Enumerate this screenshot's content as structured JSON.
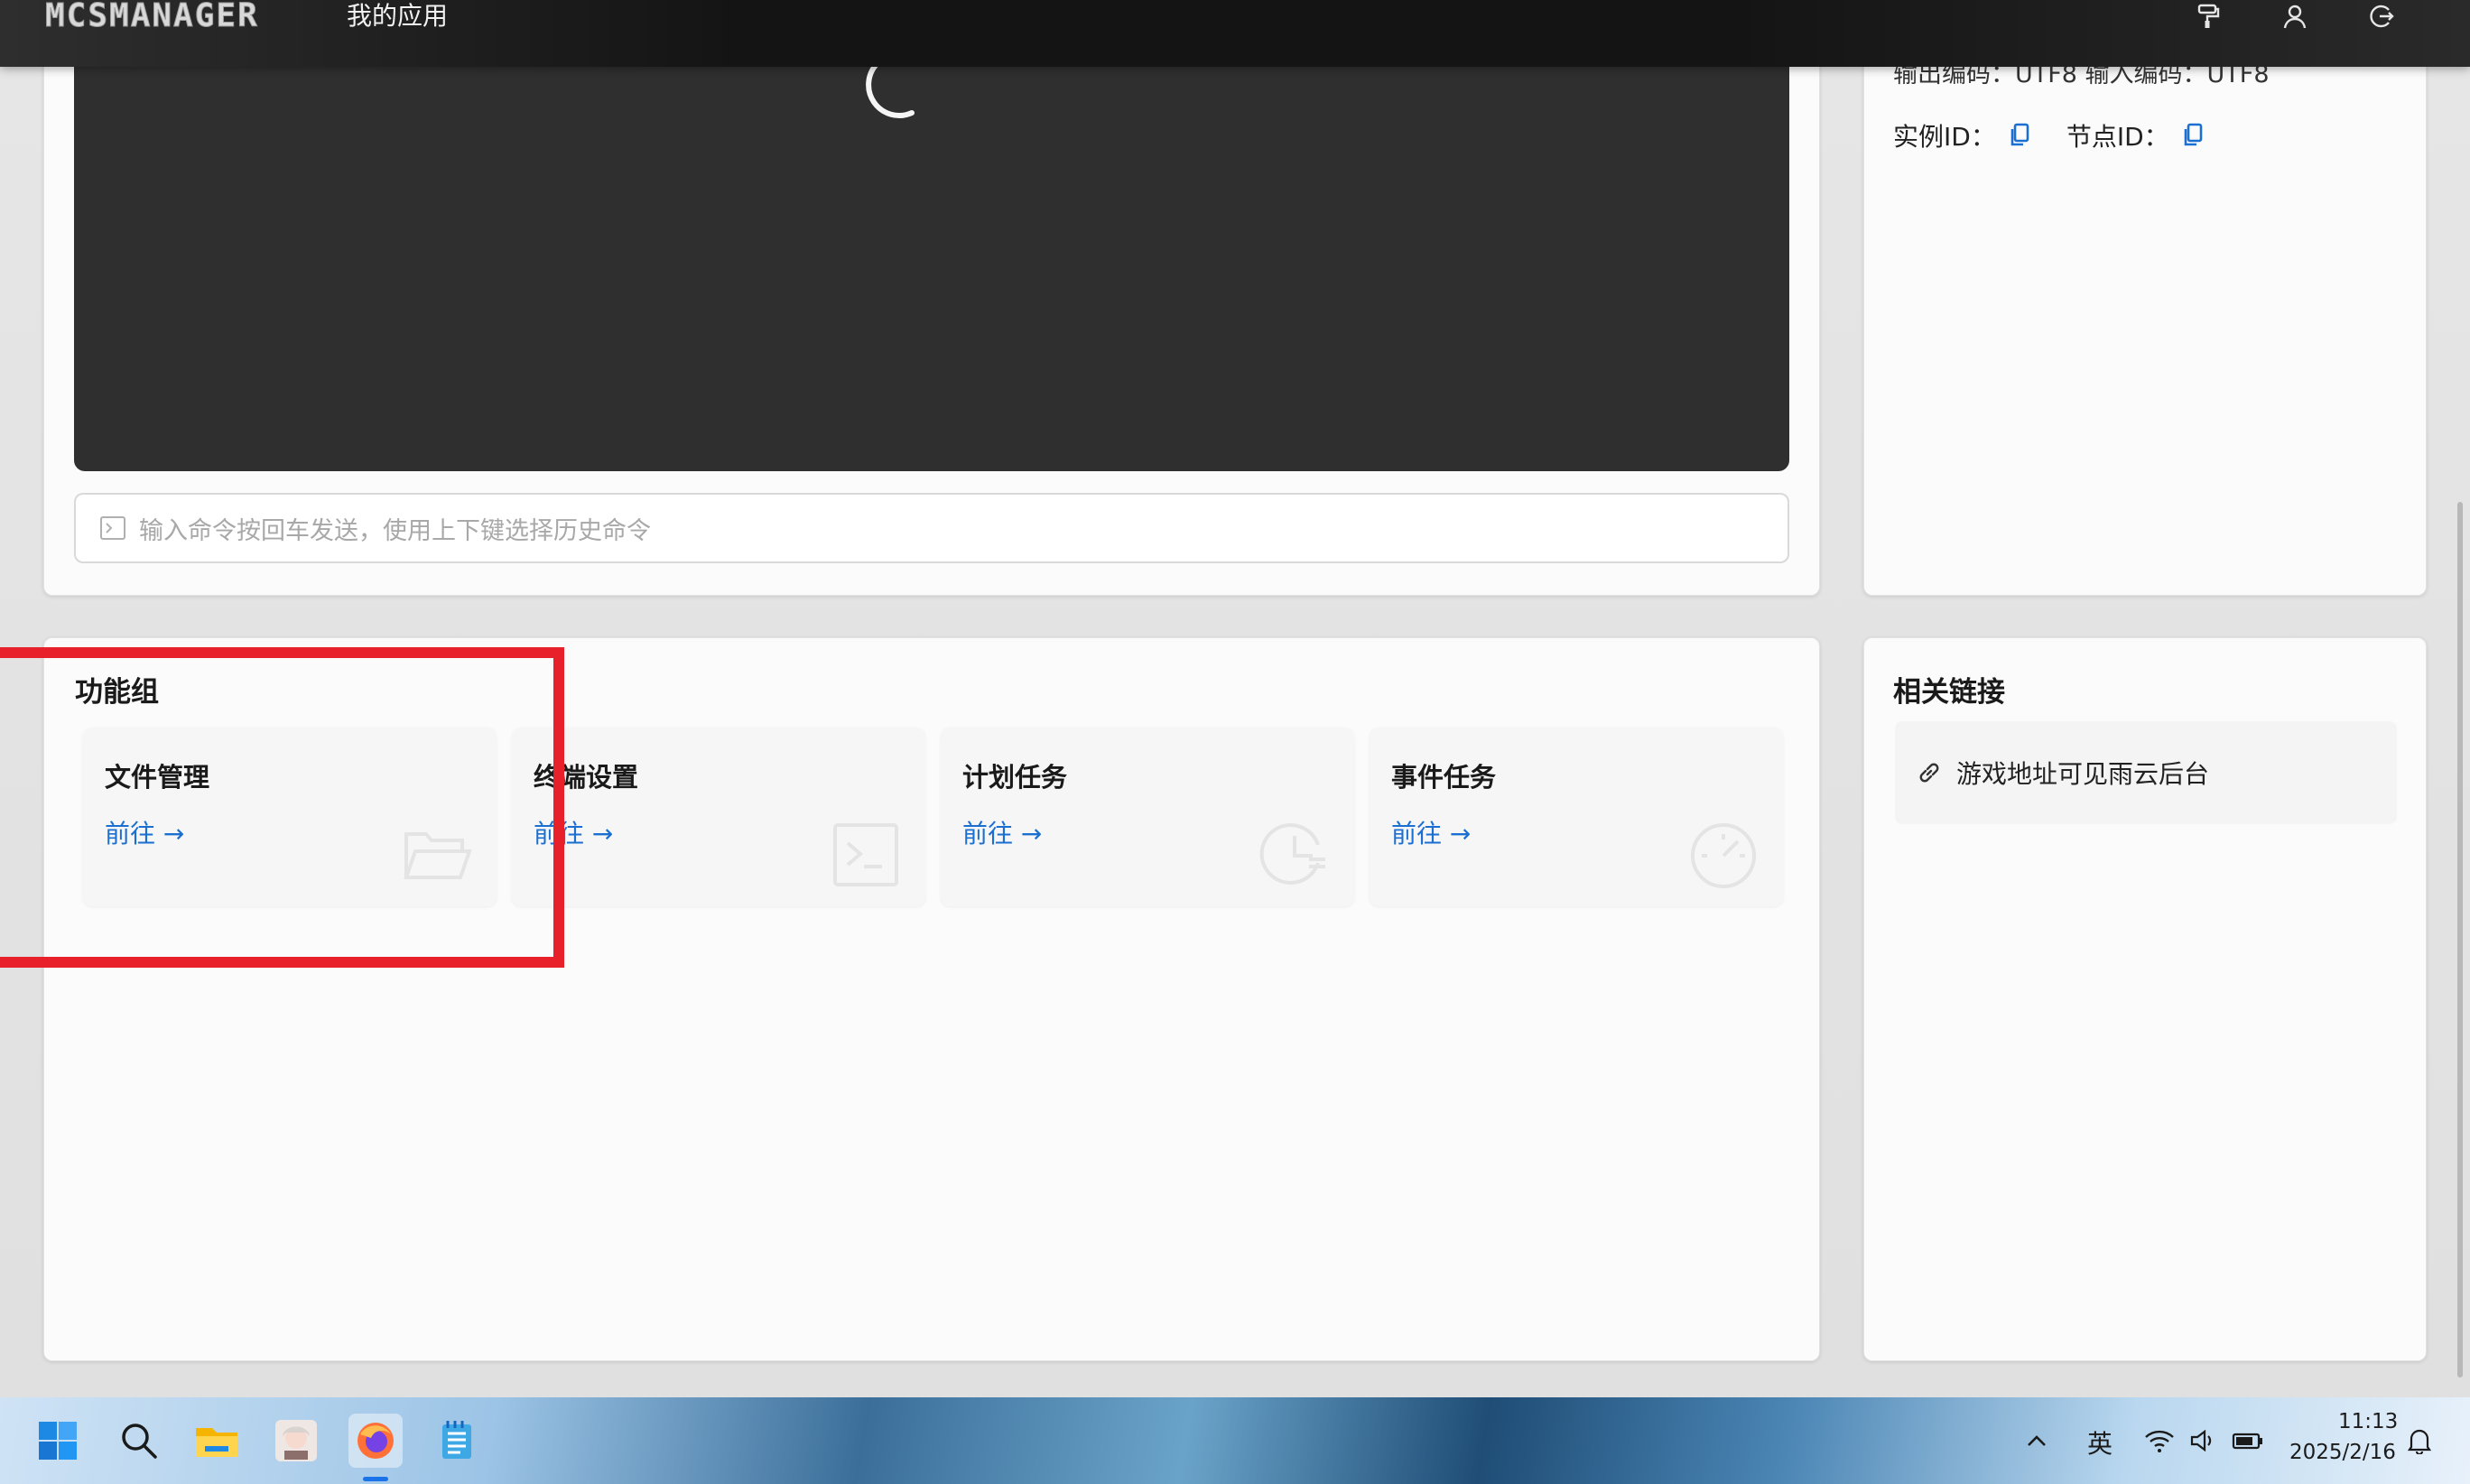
{
  "header": {
    "logo": "MCSMANAGER",
    "nav_app": "我的应用",
    "icons": [
      "paint-roller-icon",
      "user-icon",
      "logout-icon"
    ]
  },
  "info_panel": {
    "encoding_line": "输出编码：UTF8  输入编码：UTF8",
    "instance_id_label": "实例ID：",
    "node_id_label": "节点ID："
  },
  "terminal": {
    "command_placeholder": "输入命令按回车发送，使用上下键选择历史命令"
  },
  "function_group": {
    "title": "功能组",
    "items": [
      {
        "title": "文件管理",
        "link": "前往 →",
        "icon": "folder-open-icon"
      },
      {
        "title": "终端设置",
        "link": "前往 →",
        "icon": "terminal-icon"
      },
      {
        "title": "计划任务",
        "link": "前往 →",
        "icon": "clock-icon"
      },
      {
        "title": "事件任务",
        "link": "前往 →",
        "icon": "dashboard-icon"
      }
    ]
  },
  "related_links": {
    "title": "相关链接",
    "items": [
      {
        "label": "游戏地址可见雨云后台",
        "icon": "link-icon"
      }
    ]
  },
  "taskbar": {
    "apps": [
      "start-icon",
      "search-icon",
      "file-explorer-icon",
      "avatar-app-icon",
      "firefox-icon",
      "notepad-icon"
    ],
    "ime": "英",
    "time": "11:13",
    "date": "2025/2/16"
  },
  "colors": {
    "accent": "#1b6fd1",
    "highlight_box": "#e8202a"
  }
}
